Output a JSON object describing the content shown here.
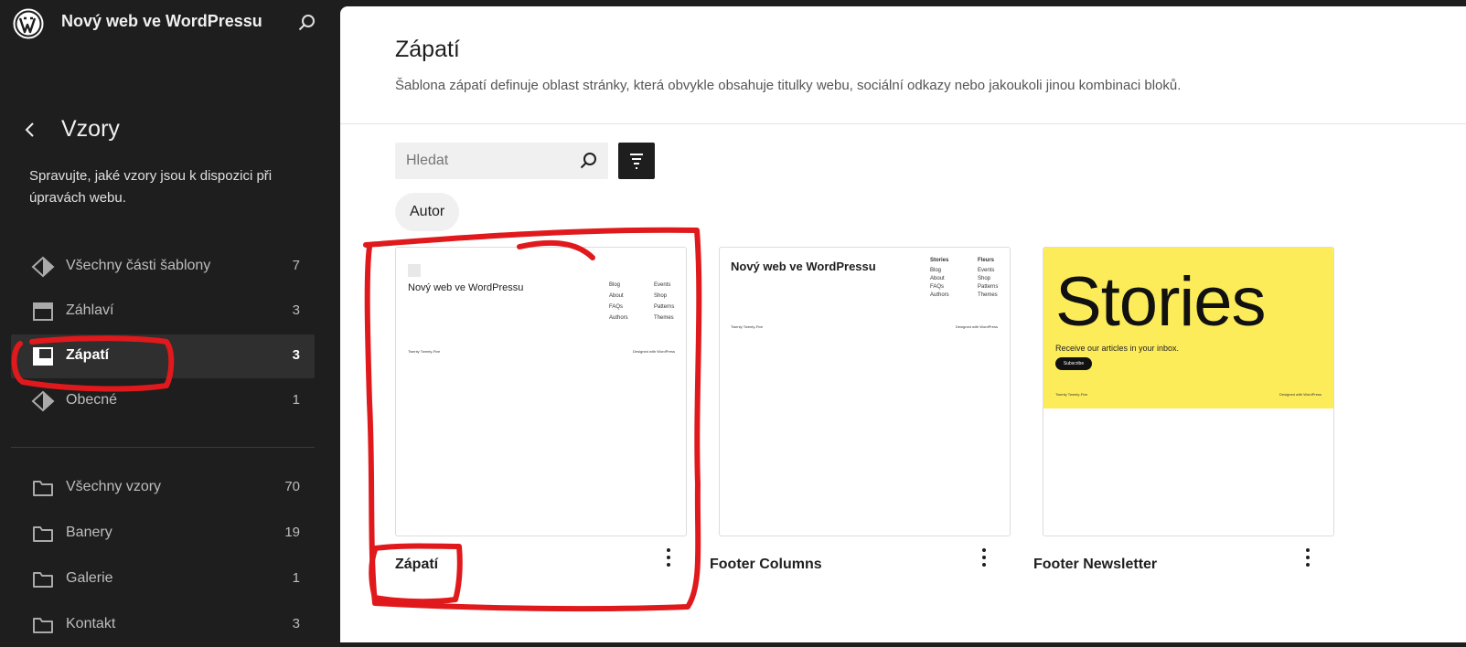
{
  "site": {
    "title": "Nový web ve WordPressu"
  },
  "sidebar": {
    "section_title": "Vzory",
    "description": "Spravujte, jaké vzory jsou k dispozici při úpravách webu.",
    "template_parts": [
      {
        "label": "Všechny části šablony",
        "count": "7",
        "icon": "diamond-icon",
        "active": false
      },
      {
        "label": "Záhlaví",
        "count": "3",
        "icon": "header-layout-icon",
        "active": false
      },
      {
        "label": "Zápatí",
        "count": "3",
        "icon": "footer-layout-icon",
        "active": true
      },
      {
        "label": "Obecné",
        "count": "1",
        "icon": "diamond-icon",
        "active": false
      }
    ],
    "pattern_categories": [
      {
        "label": "Všechny vzory",
        "count": "70",
        "icon": "folder-icon"
      },
      {
        "label": "Banery",
        "count": "19",
        "icon": "folder-icon"
      },
      {
        "label": "Galerie",
        "count": "1",
        "icon": "folder-icon"
      },
      {
        "label": "Kontakt",
        "count": "3",
        "icon": "folder-icon"
      }
    ]
  },
  "main": {
    "title": "Zápatí",
    "description": "Šablona zápatí definuje oblast stránky, která obvykle obsahuje titulky webu, sociální odkazy nebo jakoukoli jinou kombinaci bloků.",
    "search_placeholder": "Hledat",
    "filter_chip": "Autor",
    "cards": [
      {
        "title": "Zápatí",
        "preview": {
          "site": "Nový web ve WordPressu",
          "links_col1": [
            "Blog",
            "About",
            "FAQs",
            "Authors"
          ],
          "links_col2": [
            "Events",
            "Shop",
            "Patterns",
            "Themes"
          ],
          "credit_left": "Twenty Twenty-Five",
          "credit_right": "Designed with WordPress"
        }
      },
      {
        "title": "Footer Columns",
        "preview": {
          "site": "Nový web ve WordPressu",
          "col1_heading": "Stories",
          "col2_heading": "Fleurs",
          "links_col1": [
            "Blog",
            "About",
            "FAQs",
            "Authors"
          ],
          "links_col2": [
            "Events",
            "Shop",
            "Patterns",
            "Themes"
          ],
          "credit_left": "Twenty Twenty-Five",
          "credit_right": "Designed with WordPress"
        }
      },
      {
        "title": "Footer Newsletter",
        "preview": {
          "headline": "Stories",
          "text": "Receive our articles in your inbox.",
          "button": "Subscribe",
          "credit_left": "Twenty Twenty-Five",
          "credit_right": "Designed with WordPress"
        }
      }
    ]
  },
  "colors": {
    "sidebar_bg": "#1e1e1e",
    "active_item_bg": "#2f2f2f",
    "newsletter_bg": "#fdec5a",
    "annotation": "#e0191c"
  }
}
